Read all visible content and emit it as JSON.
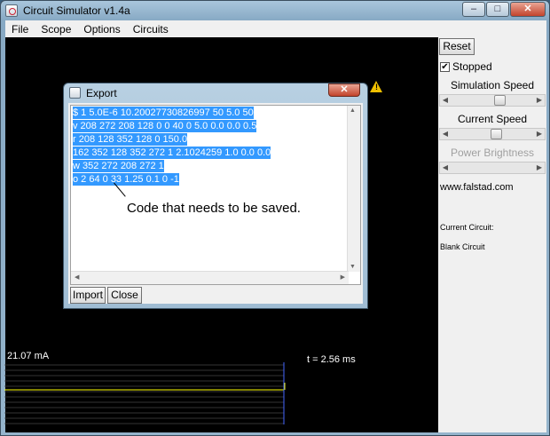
{
  "window": {
    "title": "Circuit Simulator v1.4a",
    "controls": [
      "–",
      "□",
      "✕"
    ]
  },
  "menu": [
    "File",
    "Scope",
    "Options",
    "Circuits"
  ],
  "side_panel": {
    "reset_label": "Reset",
    "stopped_label": "Stopped",
    "stopped_checked": true,
    "simulation_speed_label": "Simulation Speed",
    "simulation_speed_value": 0.6,
    "current_speed_label": "Current Speed",
    "current_speed_value": 0.55,
    "power_brightness_label": "Power Brightness",
    "website": "www.falstad.com",
    "current_circuit_label": "Current Circuit:",
    "current_circuit_value": "Blank Circuit"
  },
  "export_dialog": {
    "title": "Export",
    "code_lines": [
      "$ 1 5.0E-6 10.20027730826997 50 5.0 50",
      "v 208 272 208 128 0 0 40 0 5.0 0.0 0.0 0.5",
      "r 208 128 352 128 0 150.0",
      "162 352 128 352 272 1 2.1024259 1.0 0.0 0.0",
      "w 352 272 208 272 1",
      "o 2 64 0 33 1.25 0.1 0 -1"
    ],
    "import_label": "Import",
    "close_label": "Close"
  },
  "annotation": "Code that needs to be saved.",
  "scope": {
    "current_readout": "21.07 mA",
    "time_readout": "t = 2.56 ms"
  },
  "colors": {
    "selection": "#3399ff",
    "scope_trace": "#ffff00",
    "scope_grid": "#444444",
    "scope_marker": "#4466ff"
  }
}
